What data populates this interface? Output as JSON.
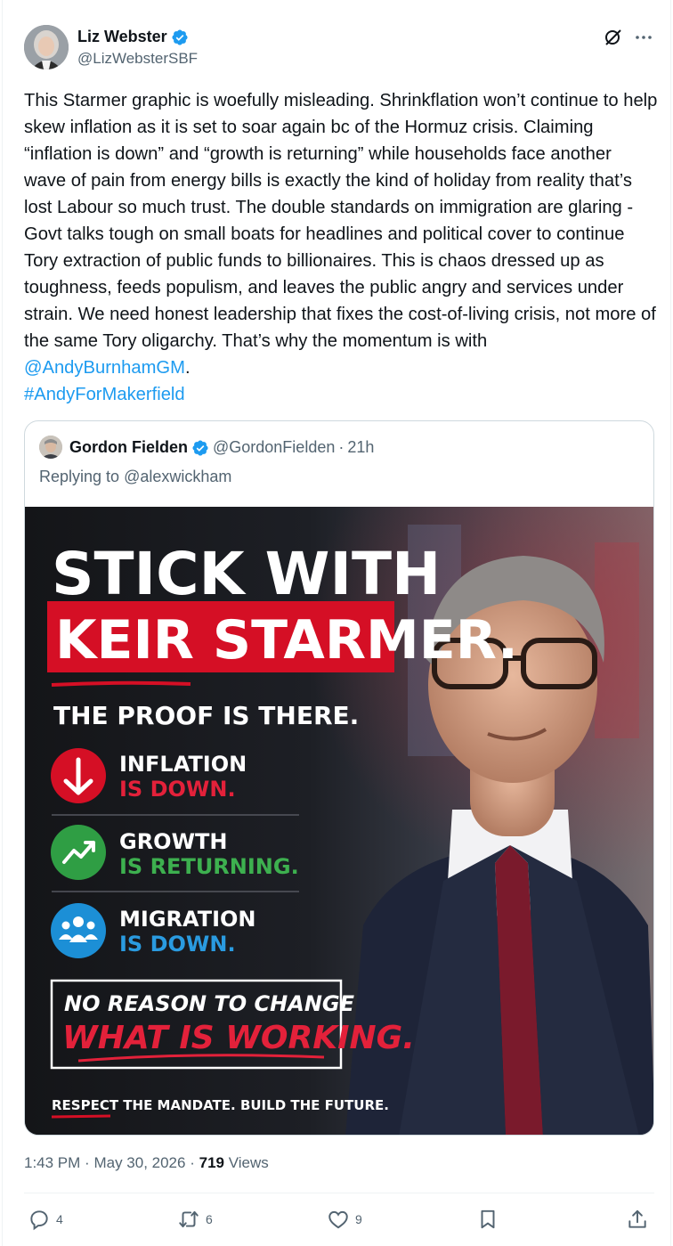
{
  "author": {
    "name": "Liz Webster",
    "handle": "@LizWebsterSBF"
  },
  "tweet": {
    "text_before": "This Starmer graphic is woefully misleading. Shrinkflation won’t continue to help skew inflation as it is set to soar again bc of the Hormuz crisis. Claiming “inflation is down” and “growth is returning” while households face another wave of pain from energy bills is exactly the kind of holiday from reality that’s lost Labour so much trust. The double standards on immigration are glaring - Govt talks tough on small boats for headlines and political cover to continue Tory extraction of public funds to billionaires. This is chaos dressed up as toughness, feeds populism, and leaves the public angry and services under strain. We need honest leadership that fixes the cost-of-living crisis, not more of the same Tory oligarchy. That’s why the momentum is with ",
    "mention": "@AndyBurnhamGM",
    "text_after": ".",
    "hashtag": "#AndyForMakerfield"
  },
  "quote": {
    "name": "Gordon Fielden",
    "handle": "@GordonFielden",
    "separator": "·",
    "age": "21h",
    "reply_prefix": "Replying to",
    "reply_to": "@alexwickham",
    "graphic": {
      "headline_1": "STICK WITH",
      "headline_2": "KEIR STARMER.",
      "proof": "THE PROOF IS THERE.",
      "item1_top": "INFLATION",
      "item1_bottom": "IS DOWN.",
      "item2_top": "GROWTH",
      "item2_bottom": "IS RETURNING.",
      "item3_top": "MIGRATION",
      "item3_bottom": "IS DOWN.",
      "box_top": "NO REASON TO CHANGE",
      "box_bottom": "WHAT IS WORKING.",
      "footer": "RESPECT THE MANDATE. BUILD THE FUTURE."
    }
  },
  "meta": {
    "time": "1:43 PM",
    "sep1": "·",
    "date": "May 30, 2026",
    "sep2": "·",
    "views_count": "719",
    "views_label": "Views"
  },
  "actions": {
    "replies": "4",
    "reposts": "6",
    "likes": "9"
  },
  "colors": {
    "link": "#1d9bf0",
    "verified": "#1d9bf0",
    "labour_red": "#d50f25",
    "growth_green": "#2f9e44",
    "migration_blue": "#1c8fd6"
  }
}
